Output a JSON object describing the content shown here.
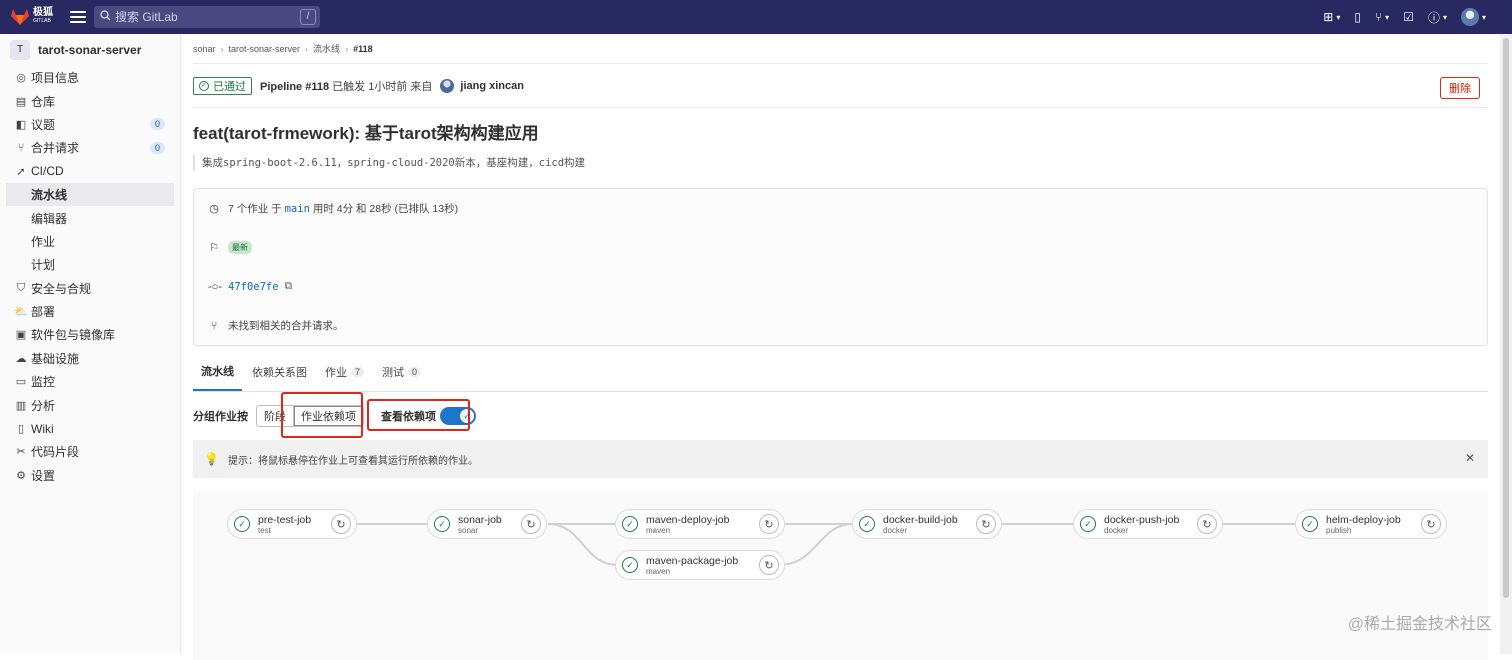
{
  "topbar": {
    "brand": "极狐",
    "brand_sub": "GITLAB",
    "search_placeholder": "搜索 GitLab",
    "search_shortcut": "/"
  },
  "sidebar": {
    "project_initial": "T",
    "project_name": "tarot-sonar-server",
    "items": [
      {
        "label": "项目信息",
        "icon": "info-icon"
      },
      {
        "label": "仓库",
        "icon": "repository-icon"
      },
      {
        "label": "议题",
        "icon": "issues-icon",
        "count": "0"
      },
      {
        "label": "合并请求",
        "icon": "merge-request-icon",
        "count": "0"
      },
      {
        "label": "CI/CD",
        "icon": "rocket-icon"
      },
      {
        "label": "流水线",
        "sub": true,
        "active": true
      },
      {
        "label": "编辑器",
        "sub": true
      },
      {
        "label": "作业",
        "sub": true
      },
      {
        "label": "计划",
        "sub": true
      },
      {
        "label": "安全与合规",
        "icon": "shield-icon"
      },
      {
        "label": "部署",
        "icon": "deploy-icon"
      },
      {
        "label": "软件包与镜像库",
        "icon": "package-icon"
      },
      {
        "label": "基础设施",
        "icon": "cloud-icon"
      },
      {
        "label": "监控",
        "icon": "monitor-icon"
      },
      {
        "label": "分析",
        "icon": "chart-icon"
      },
      {
        "label": "Wiki",
        "icon": "book-icon"
      },
      {
        "label": "代码片段",
        "icon": "snippet-icon"
      },
      {
        "label": "设置",
        "icon": "gear-icon"
      }
    ]
  },
  "breadcrumb": [
    "sonar",
    "tarot-sonar-server",
    "流水线",
    "#118"
  ],
  "pipeline": {
    "status": "已通过",
    "id_label": "Pipeline #118",
    "triggered_text": "已触发 1小时前 来自",
    "user": "jiang xincan",
    "delete_label": "删除",
    "commit_title": "feat(tarot-frmework): 基于tarot架构构建应用",
    "commit_desc": "集成spring-boot-2.6.11，spring-cloud-2020新本，基座构建，cicd构建"
  },
  "info": {
    "jobs_prefix": "7 个作业 于",
    "branch": "main",
    "jobs_suffix": "用时 4分 和 28秒 (已排队 13秒)",
    "latest_badge": "最新",
    "commit_sha": "47f0e7fe",
    "mr_text": "未找到相关的合并请求。"
  },
  "tabs": [
    {
      "label": "流水线",
      "active": true
    },
    {
      "label": "依赖关系图"
    },
    {
      "label": "作业",
      "count": "7"
    },
    {
      "label": "测试",
      "count": "0"
    }
  ],
  "grouping": {
    "label": "分组作业按",
    "stage_button": "阶段",
    "deps_button": "作业依赖项",
    "view_deps_label": "查看依赖项",
    "toggle_on": true
  },
  "alert": {
    "text": "提示：将鼠标悬停在作业上可查看其运行所依赖的作业。"
  },
  "jobs": [
    {
      "name": "pre-test-job",
      "stage": "test"
    },
    {
      "name": "sonar-job",
      "stage": "sonar"
    },
    {
      "name": "maven-deploy-job",
      "stage": "maven"
    },
    {
      "name": "maven-package-job",
      "stage": "maven"
    },
    {
      "name": "docker-build-job",
      "stage": "docker"
    },
    {
      "name": "docker-push-job",
      "stage": "docker"
    },
    {
      "name": "helm-deploy-job",
      "stage": "publish"
    }
  ],
  "watermark": "@稀土掘金技术社区",
  "colors": {
    "topbar": "#292961",
    "success": "#217645",
    "accent": "#1f75cb",
    "danger": "#dd2b0e",
    "highlight": "#e0241e"
  }
}
